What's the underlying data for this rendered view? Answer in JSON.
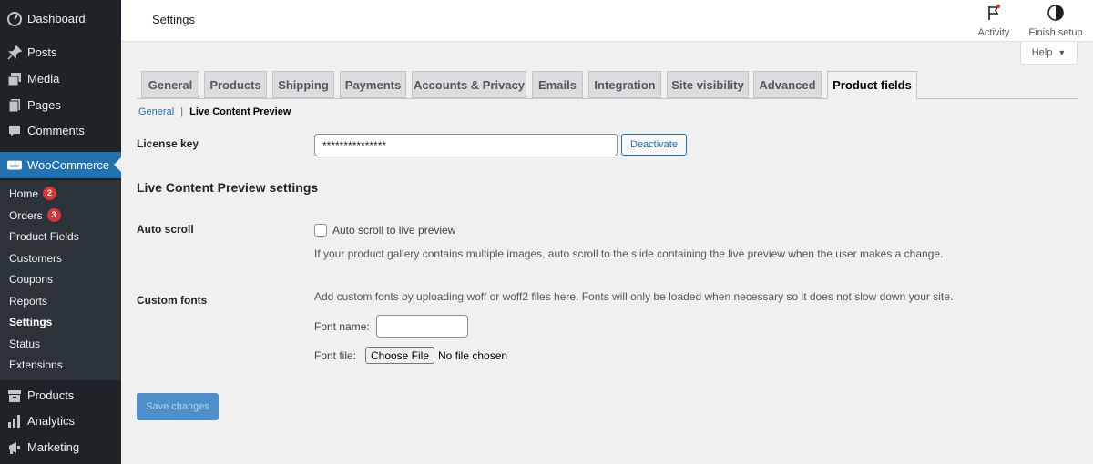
{
  "sidebar": {
    "items": [
      {
        "label": "Dashboard",
        "icon": "dashboard-icon"
      },
      {
        "label": "Posts",
        "icon": "pin-icon"
      },
      {
        "label": "Media",
        "icon": "media-icon"
      },
      {
        "label": "Pages",
        "icon": "pages-icon"
      },
      {
        "label": "Comments",
        "icon": "comments-icon"
      },
      {
        "label": "WooCommerce",
        "icon": "woo-icon"
      },
      {
        "label": "Products",
        "icon": "archive-icon"
      },
      {
        "label": "Analytics",
        "icon": "chart-bar-icon"
      },
      {
        "label": "Marketing",
        "icon": "megaphone-icon"
      }
    ],
    "woo_submenu": [
      {
        "label": "Home",
        "badge": "2"
      },
      {
        "label": "Orders",
        "badge": "3"
      },
      {
        "label": "Product Fields"
      },
      {
        "label": "Customers"
      },
      {
        "label": "Coupons"
      },
      {
        "label": "Reports"
      },
      {
        "label": "Settings"
      },
      {
        "label": "Status"
      },
      {
        "label": "Extensions"
      }
    ]
  },
  "header": {
    "title": "Settings",
    "activity_label": "Activity",
    "finish_setup_label": "Finish setup",
    "help_label": "Help"
  },
  "tabs": [
    "General",
    "Products",
    "Shipping",
    "Payments",
    "Accounts & Privacy",
    "Emails",
    "Integration",
    "Site visibility",
    "Advanced",
    "Product fields"
  ],
  "subnav": {
    "general_link": "General",
    "separator": "|",
    "current": "Live Content Preview"
  },
  "license": {
    "label": "License key",
    "value": "***************",
    "deactivate_label": "Deactivate"
  },
  "section_title": "Live Content Preview settings",
  "auto_scroll": {
    "label": "Auto scroll",
    "checkbox_label": "Auto scroll to live preview",
    "checked": false,
    "description": "If your product gallery contains multiple images, auto scroll to the slide containing the live preview when the user makes a change."
  },
  "custom_fonts": {
    "label": "Custom fonts",
    "description": "Add custom fonts by uploading woff or woff2 files here. Fonts will only be loaded when necessary so it does not slow down your site.",
    "font_name_label": "Font name:",
    "font_name_value": "",
    "font_file_label": "Font file:",
    "choose_file_label": "Choose File",
    "no_file_text": "No file chosen"
  },
  "save_label": "Save changes",
  "colors": {
    "sidebar_bg": "#1d2327",
    "accent": "#2271b1",
    "badge": "#d63638",
    "save_disabled": "#4d8ecb"
  }
}
